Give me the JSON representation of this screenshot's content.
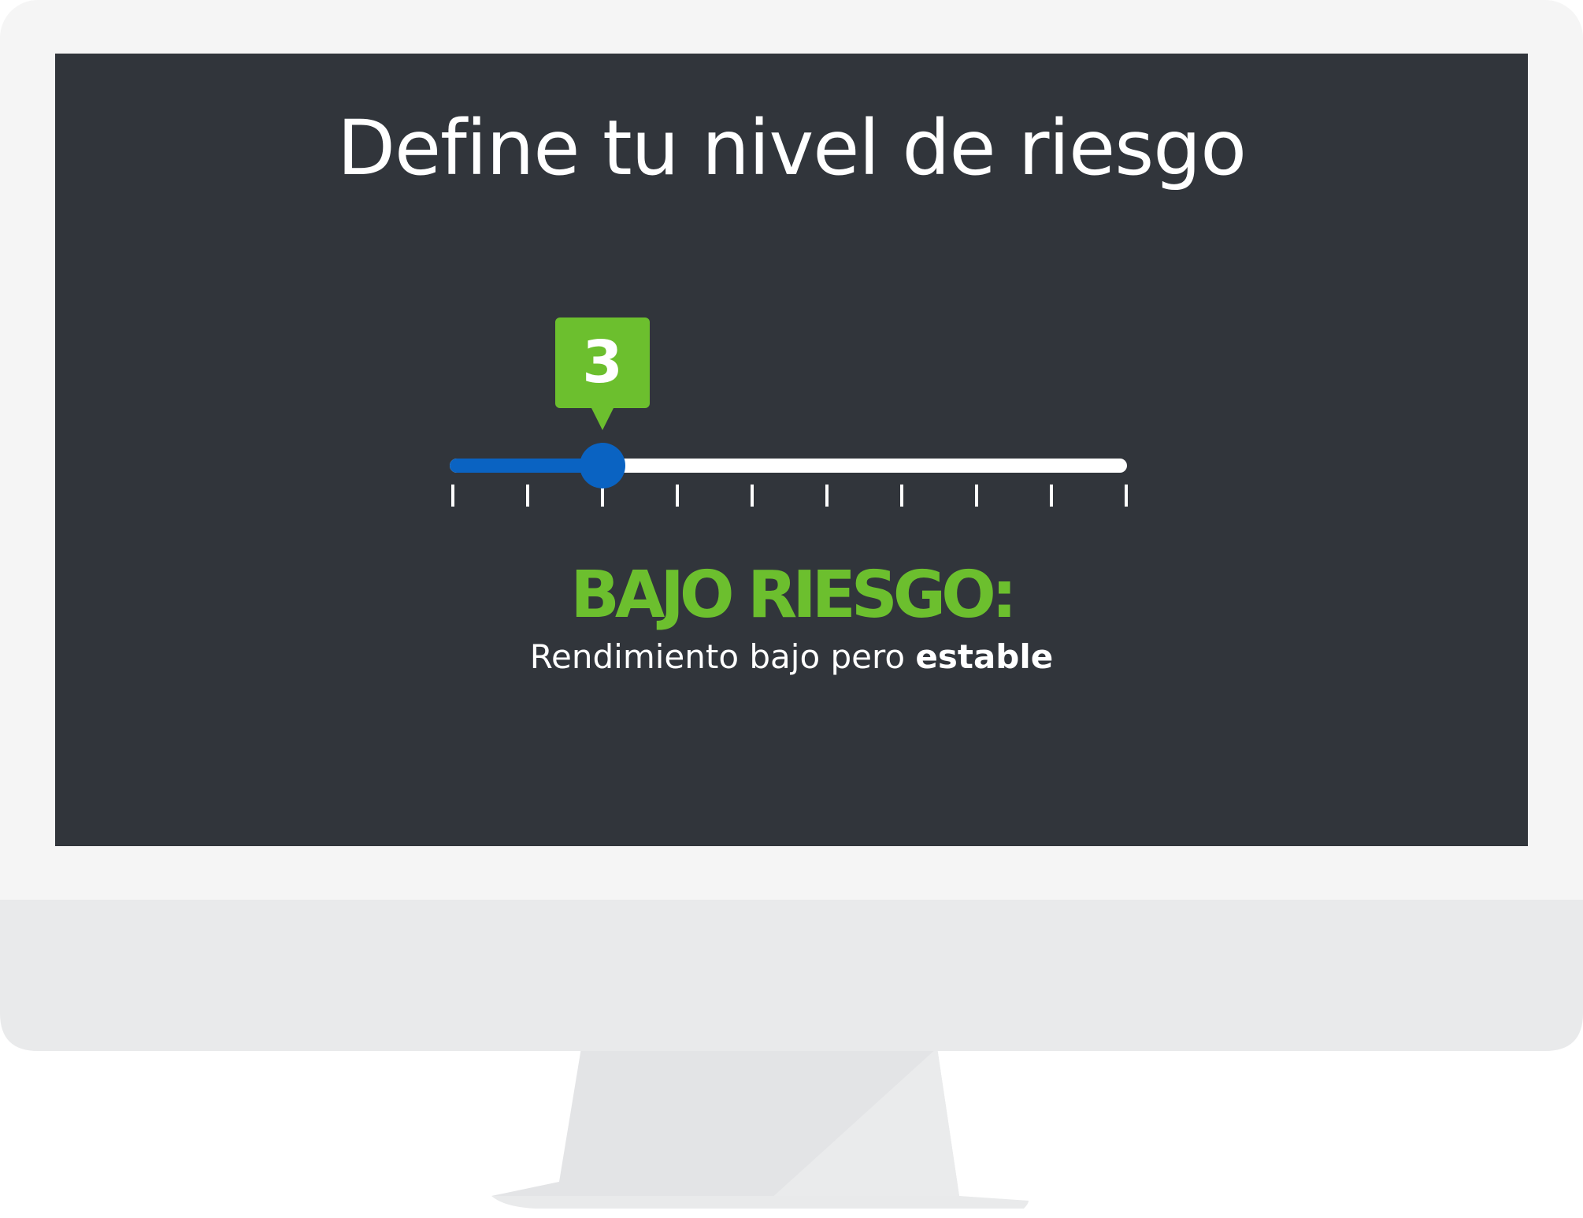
{
  "screen": {
    "title": "Define tu nivel de riesgo"
  },
  "risk_slider": {
    "value": "3",
    "value_number": 3,
    "min": 1,
    "max": 10,
    "tick_count": 10,
    "fill_color": "#0a63c2",
    "track_color": "#ffffff",
    "bubble_color": "#6cbf2e"
  },
  "result": {
    "label": "BAJO RIESGO:",
    "description_prefix": "Rendimiento bajo pero",
    "description_emphasis": "estable",
    "label_color": "#6cbf2e"
  },
  "colors": {
    "screen_background": "#31353b",
    "bezel": "#f5f5f5",
    "chin": "#e9eaeb",
    "stand": "#e1e2e4"
  }
}
